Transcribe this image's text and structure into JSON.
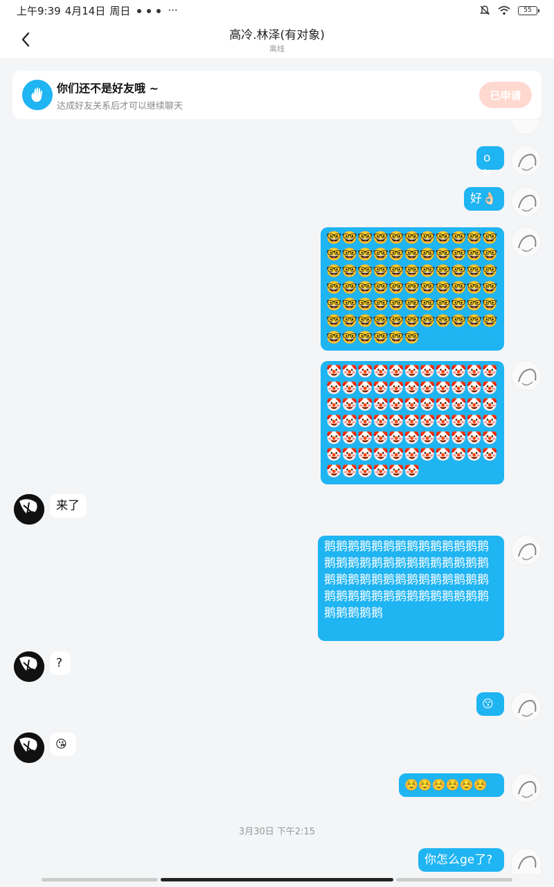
{
  "status_bar": {
    "time": "上午9:39",
    "date": "4月14日",
    "weekday": "周日",
    "more": "···",
    "battery": "55"
  },
  "header": {
    "title": "高冷.林泽(有对象)",
    "status": "离线"
  },
  "friend_banner": {
    "title": "你们还不是好友哦 ~",
    "subtitle": "达成好友关系后才可以继续聊天",
    "button": "已申请"
  },
  "messages": [
    {
      "from": "me",
      "text": "oh"
    },
    {
      "from": "me",
      "text": "好👌🏻"
    },
    {
      "from": "me",
      "emoji": "🤓",
      "count": 72
    },
    {
      "from": "me",
      "emoji": "🤡",
      "count": 72
    },
    {
      "from": "them",
      "text": "来了"
    },
    {
      "from": "me",
      "text": "鹅鹅鹅鹅鹅鹅鹅鹅鹅鹅鹅鹅鹅鹅鹅鹅鹅鹅鹅鹅鹅鹅鹅鹅鹅鹅鹅鹅鹅鹅鹅鹅鹅鹅鹅鹅鹅鹅鹅鹅鹅鹅鹅鹅鹅鹅鹅鹅鹅鹅鹅鹅鹅鹅鹅鹅鹅鹅鹅鹅鹅"
    },
    {
      "from": "them",
      "text": "?"
    },
    {
      "from": "me",
      "text": "😗"
    },
    {
      "from": "them",
      "text": "😘"
    },
    {
      "from": "me",
      "text": "☺️☺️☺️☺️☺️☺️"
    },
    {
      "from": "me",
      "text": "你怎么ge了?"
    }
  ],
  "timestamp": "3月30日 下午2:15",
  "colors": {
    "accent": "#1fb4f2",
    "background": "#f4f5f7",
    "apply_button": "#ffd9cf"
  }
}
